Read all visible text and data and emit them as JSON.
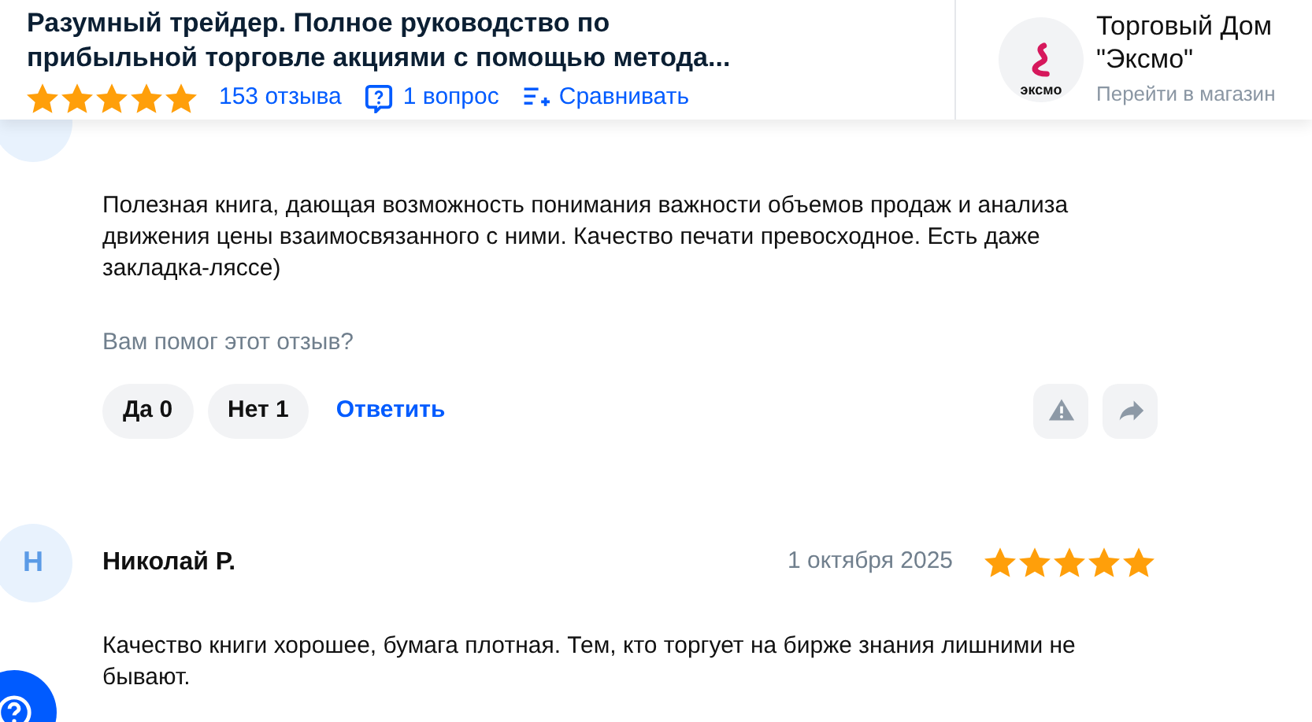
{
  "header": {
    "title": "Разумный трейдер. Полное руководство по прибыльной торговле акциями с помощью метода...",
    "stars": 5,
    "reviews_link": "153 отзыва",
    "questions_link": "1 вопрос",
    "compare_link": "Сравнивать"
  },
  "store": {
    "logo_text": "эксмо",
    "name": "Торговый Дом \"Эксмо\"",
    "link": "Перейти в магазин"
  },
  "reviews": [
    {
      "text": "Полезная книга, дающая возможность понимания важности объемов продаж и анализа движения цены взаимосвязанного с ними. Качество печати превосходное. Есть даже закладка-ляссе)",
      "helpful_question": "Вам помог этот отзыв?",
      "yes": "Да 0",
      "no": "Нет 1",
      "reply": "Ответить"
    },
    {
      "initial": "Н",
      "author": "Николай Р.",
      "date": "1 октября 2025",
      "stars": 5,
      "text": "Качество книги хорошее, бумага плотная. Тем, кто торгует на бирже знания лишними не бывают."
    }
  ]
}
